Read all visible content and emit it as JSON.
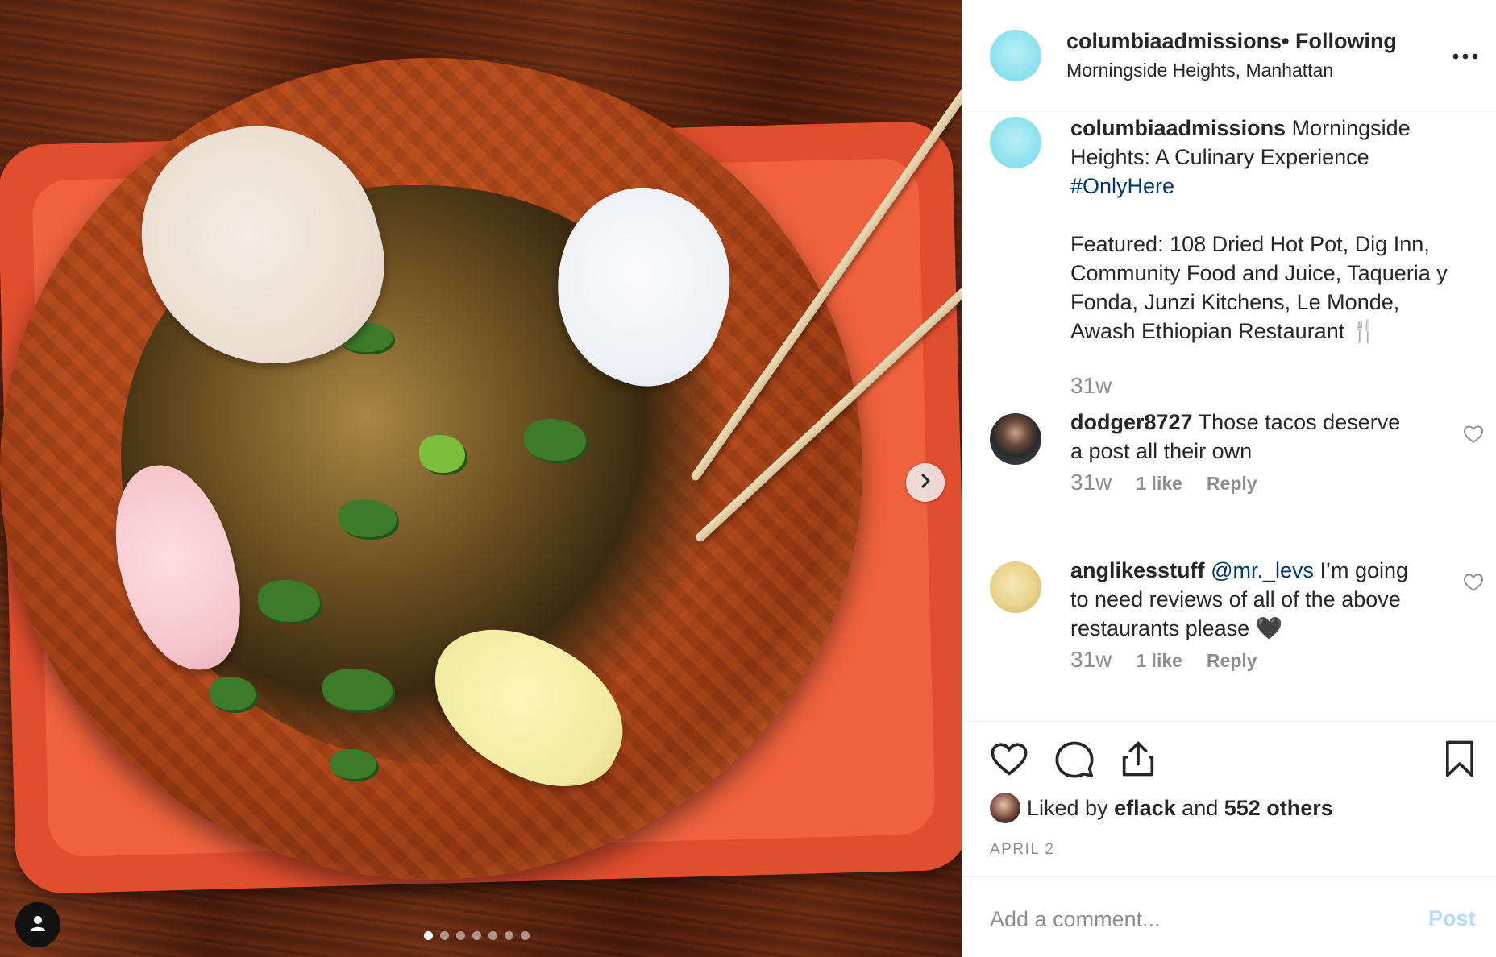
{
  "post": {
    "author": "columbiaadmissions",
    "follow_status": "• Following",
    "location": "Morningside Heights, Manhattan",
    "caption_line1": "Morningside",
    "caption_line2": "Heights: A Culinary Experience",
    "hashtag": "#OnlyHere",
    "featured_line1": "Featured: 108 Dried Hot Pot, Dig Inn,",
    "featured_line2": "Community Food and Juice, Taqueria y",
    "featured_line3": "Fonda, Junzi Kitchens, Le Monde,",
    "featured_line4": "Awash Ethiopian Restaurant 🍴",
    "time": "31w"
  },
  "carousel": {
    "image_count": 7,
    "active_index": 0,
    "next_icon": "chevron-right-icon",
    "tag_icon": "user-icon"
  },
  "comments": [
    {
      "username": "dodger8727",
      "line1": "Those tacos deserve",
      "line2": "a post all their own",
      "time": "31w",
      "likes": "1 like",
      "reply": "Reply"
    },
    {
      "username": "anglikesstuff",
      "mention": "@mr._levs",
      "line1": "I’m going",
      "line2": "to need reviews of all of the above",
      "line3": "restaurants please 🖤",
      "time": "31w",
      "likes": "1 like",
      "reply": "Reply"
    }
  ],
  "actions": {
    "icons": [
      "heart-icon",
      "comment-icon",
      "share-icon",
      "bookmark-icon"
    ],
    "liked_prefix": "Liked by",
    "liked_user": "eflack",
    "liked_and": "and",
    "liked_others": "552 others",
    "date": "APRIL 2"
  },
  "comment_box": {
    "placeholder": "Add a comment...",
    "post_label": "Post"
  },
  "colors": {
    "link": "#00376b",
    "muted": "#8e8e8e",
    "post_disabled": "#b3dbff",
    "avatar_cyan": "#8fe2ef"
  }
}
